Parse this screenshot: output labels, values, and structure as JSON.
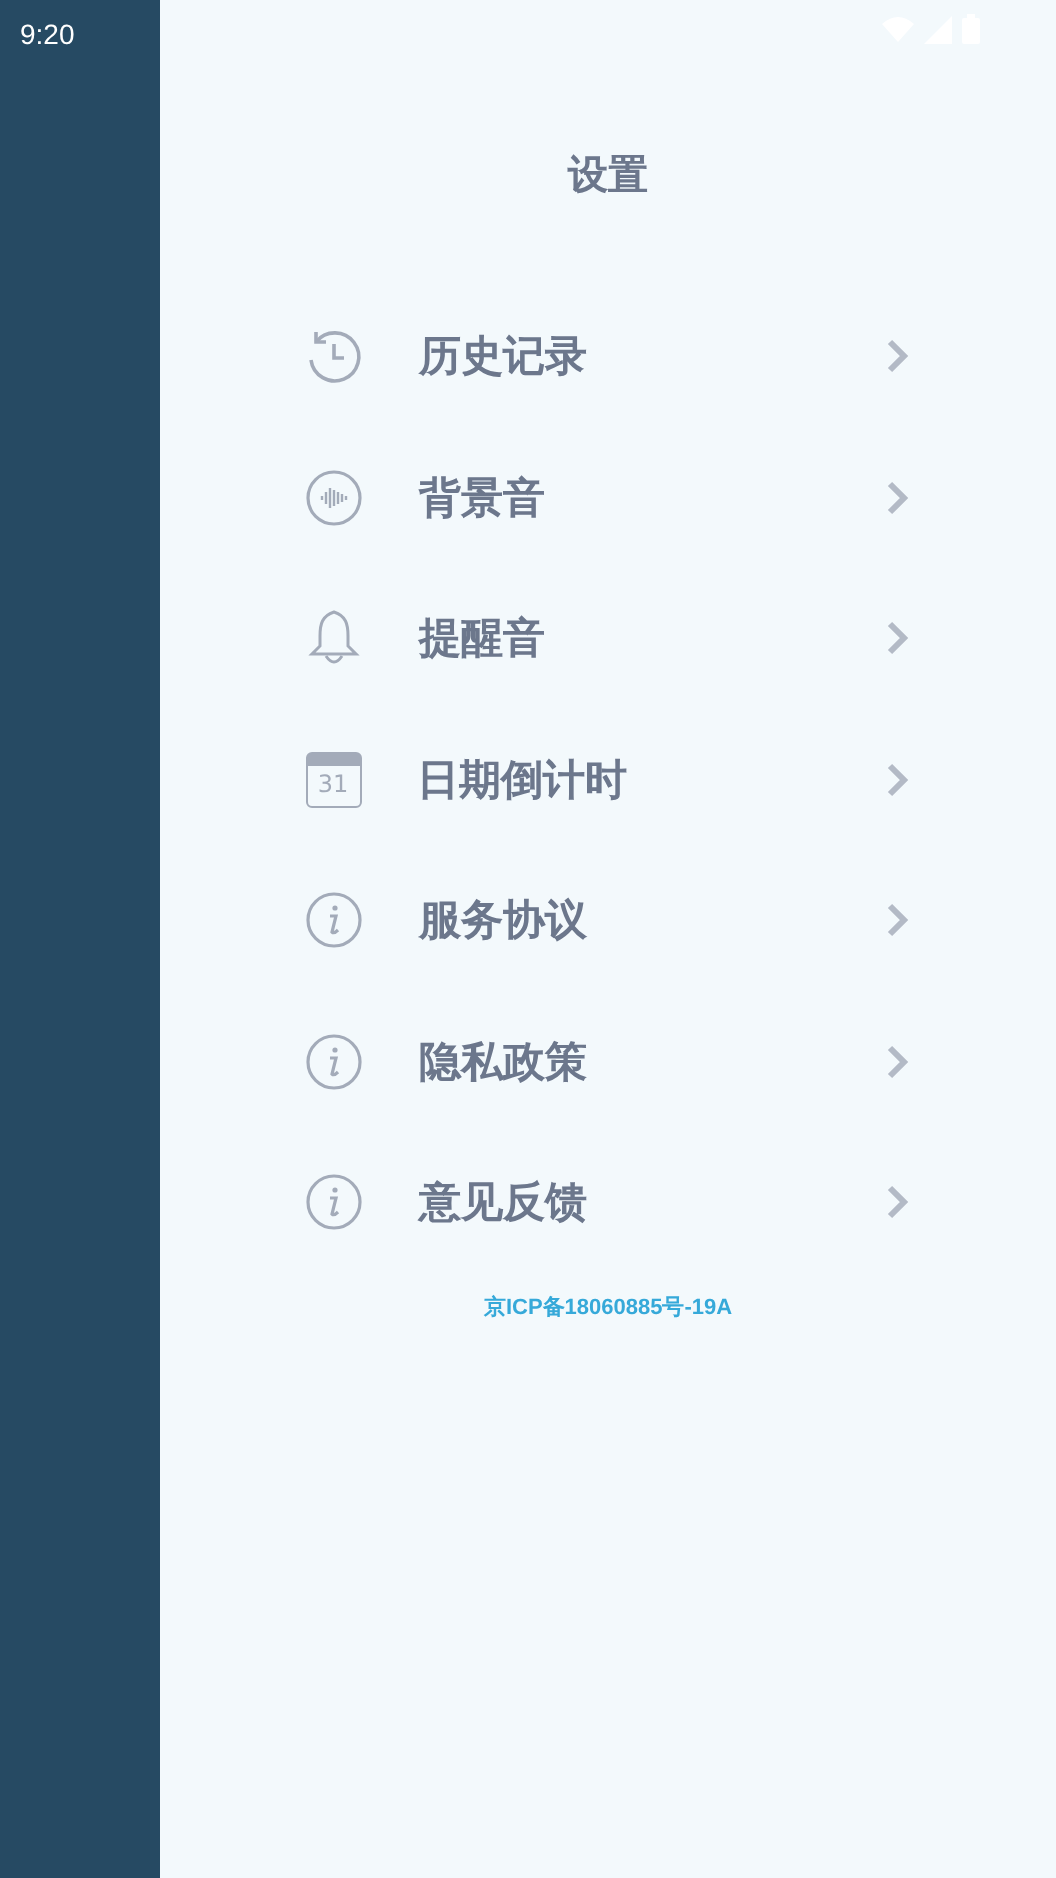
{
  "status_bar": {
    "time": "9:20"
  },
  "title": "设置",
  "items": [
    {
      "label": "历史记录",
      "kind": "history"
    },
    {
      "label": "背景音",
      "kind": "sound"
    },
    {
      "label": "提醒音",
      "kind": "bell"
    },
    {
      "label": "日期倒计时",
      "kind": "calendar",
      "icon_text": "31"
    },
    {
      "label": "服务协议",
      "kind": "info"
    },
    {
      "label": "隐私政策",
      "kind": "info"
    },
    {
      "label": "意见反馈",
      "kind": "info"
    }
  ],
  "footer_link": "京ICP备18060885号-19A"
}
